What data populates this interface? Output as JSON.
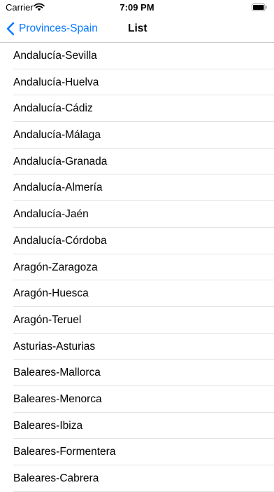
{
  "status_bar": {
    "carrier": "Carrier",
    "time": "7:09 PM",
    "wifi_icon": "wifi-icon",
    "battery_icon": "battery-icon"
  },
  "nav": {
    "back_label": "Provinces-Spain",
    "back_icon": "chevron-left-icon",
    "title": "List",
    "accent_color": "#0a7aff"
  },
  "list": {
    "items": [
      "Andalucía-Sevilla",
      "Andalucía-Huelva",
      "Andalucía-Cádiz",
      "Andalucía-Málaga",
      "Andalucía-Granada",
      "Andalucía-Almería",
      "Andalucía-Jaén",
      "Andalucía-Córdoba",
      "Aragón-Zaragoza",
      "Aragón-Huesca",
      "Aragón-Teruel",
      "Asturias-Asturias",
      "Baleares-Mallorca",
      "Baleares-Menorca",
      "Baleares-Ibiza",
      "Baleares-Formentera",
      "Baleares-Cabrera"
    ]
  }
}
